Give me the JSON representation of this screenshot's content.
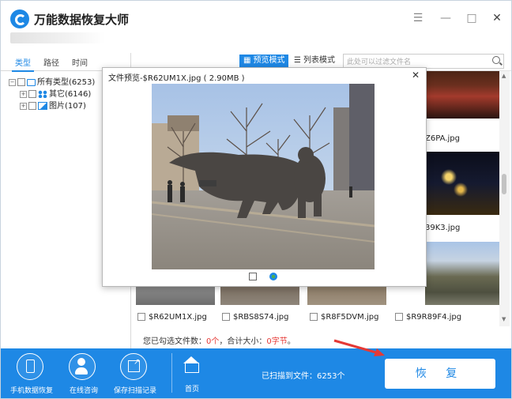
{
  "app": {
    "title": "万能数据恢复大师"
  },
  "window_controls": {
    "menu": "☰",
    "minimize": "—",
    "maximize": "□",
    "close": "✕"
  },
  "left_tabs": [
    "类型",
    "路径",
    "时间"
  ],
  "tree": [
    {
      "label": "所有类型(6253)",
      "expander": "−"
    },
    {
      "label": "其它(6146)",
      "expander": "+"
    },
    {
      "label": "图片(107)",
      "expander": "+"
    }
  ],
  "toolbar": {
    "preview_mode": "预览模式",
    "list_mode": "列表模式",
    "search_placeholder": "此处可以过滤文件名"
  },
  "grid": {
    "partial_labels": [
      "Z6PA.jpg",
      "39K3.jpg"
    ],
    "bottom_row": [
      "$R62UM1X.jpg",
      "$RBS8S74.jpg",
      "$R8F5DVM.jpg",
      "$R9R89F4.jpg"
    ]
  },
  "status": {
    "prefix": "您已勾选文件数：",
    "count": "0个",
    "mid": "，合计大小：",
    "size": "0字节",
    "suffix": "。"
  },
  "preview_dialog": {
    "title": "文件预览-$R62UM1X.jpg ( 2.90MB )",
    "close": "✕"
  },
  "bottom_bar": {
    "buttons": [
      "手机数据恢复",
      "在线咨询",
      "保存扫描记录"
    ],
    "home": "首页",
    "scanned": "已扫描到文件：6253个",
    "recover": "恢 复"
  },
  "colors": {
    "accent": "#1e88e5",
    "highlight": "#e53935"
  }
}
